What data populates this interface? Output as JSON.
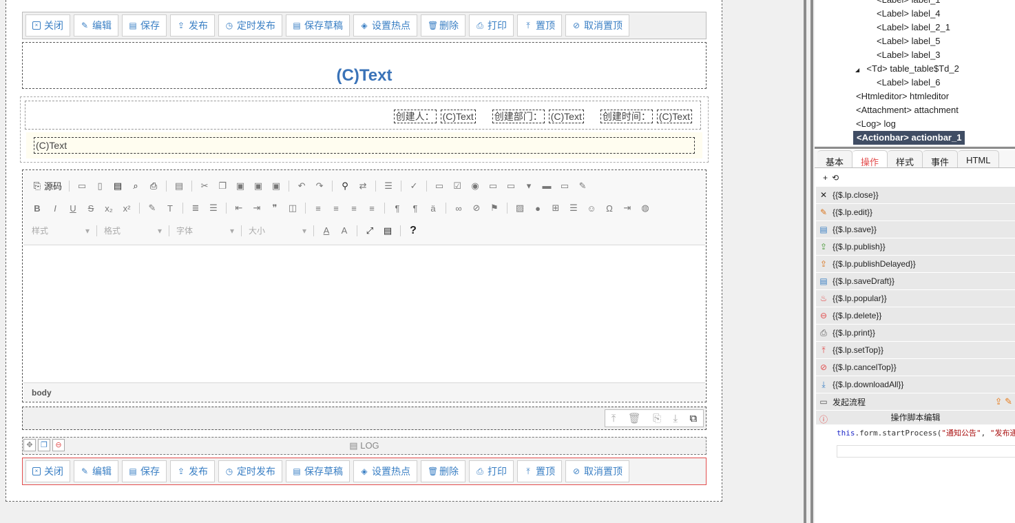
{
  "actionbar_top": {
    "buttons": [
      {
        "icon": "close-box-icon",
        "label": "关闭"
      },
      {
        "icon": "pencil-icon",
        "label": "编辑"
      },
      {
        "icon": "save-icon",
        "label": "保存"
      },
      {
        "icon": "publish-icon",
        "label": "发布"
      },
      {
        "icon": "timer-doc-icon",
        "label": "定时发布"
      },
      {
        "icon": "save-icon",
        "label": "保存草稿"
      },
      {
        "icon": "hotspot-icon",
        "label": "设置热点"
      },
      {
        "icon": "trash-icon",
        "label": "删除"
      },
      {
        "icon": "printer-icon",
        "label": "打印"
      },
      {
        "icon": "pin-top-icon",
        "label": "置顶"
      },
      {
        "icon": "cancel-top-icon",
        "label": "取消置顶"
      }
    ]
  },
  "form": {
    "title": "(C)Text",
    "creator_label": "创建人：",
    "creator_value": "(C)Text",
    "dept_label": "创建部门：",
    "dept_value": "(C)Text",
    "time_label": "创建时间：",
    "time_value": "(C)Text",
    "text_field": "(C)Text"
  },
  "editor": {
    "source_label": "源码",
    "style_dd": "样式",
    "format_dd": "格式",
    "font_dd": "字体",
    "size_dd": "大小",
    "help": "?",
    "status_path": "body"
  },
  "log": {
    "label": "LOG"
  },
  "tree": {
    "nodes": [
      {
        "text": "<Label> label_1",
        "indent": 90
      },
      {
        "text": "<Label> label_4",
        "indent": 90
      },
      {
        "text": "<Label> label_2_1",
        "indent": 90
      },
      {
        "text": "<Label> label_5",
        "indent": 90
      },
      {
        "text": "<Label> label_3",
        "indent": 90
      },
      {
        "text": "<Td> table_table$Td_2",
        "indent": 75,
        "expander": "◢"
      },
      {
        "text": "<Label> label_6",
        "indent": 90
      },
      {
        "text": "<Htmleditor> htmleditor",
        "indent": 60
      },
      {
        "text": "<Attachment> attachment",
        "indent": 60
      },
      {
        "text": "<Log> log",
        "indent": 60
      },
      {
        "text": "<Actionbar> actionbar_1",
        "indent": 56,
        "selected": true
      }
    ]
  },
  "props": {
    "tabs": [
      {
        "label": "基本"
      },
      {
        "label": "操作",
        "active": true
      },
      {
        "label": "样式"
      },
      {
        "label": "事件"
      },
      {
        "label": "HTML"
      }
    ],
    "toolbar_add": "+",
    "toolbar_refresh": "⟲",
    "actions": [
      {
        "icon": "x-icon",
        "label": "{{$.lp.close}}"
      },
      {
        "icon": "pencil-icon",
        "label": "{{$.lp.edit}}"
      },
      {
        "icon": "save-icon",
        "label": "{{$.lp.save}}"
      },
      {
        "icon": "publish-icon",
        "label": "{{$.lp.publish}}"
      },
      {
        "icon": "publish-delayed-icon",
        "label": "{{$.lp.publishDelayed}}"
      },
      {
        "icon": "save-icon",
        "label": "{{$.lp.saveDraft}}"
      },
      {
        "icon": "flame-icon",
        "label": "{{$.lp.popular}}"
      },
      {
        "icon": "delete-circle-icon",
        "label": "{{$.lp.delete}}"
      },
      {
        "icon": "printer-icon",
        "label": "{{$.lp.print}}"
      },
      {
        "icon": "pin-top-icon",
        "label": "{{$.lp.setTop}}"
      },
      {
        "icon": "cancel-top-icon",
        "label": "{{$.lp.cancelTop}}"
      },
      {
        "icon": "download-icon",
        "label": "{{$.lp.downloadAll}}"
      },
      {
        "icon": "flow-icon",
        "label": "发起流程"
      }
    ],
    "script_header": "操作脚本编辑",
    "code_kw": "this",
    "code_rest": ".form.startProcess(",
    "code_str1": "\"通知公告\"",
    "code_sep": ", ",
    "code_str2": "\"发布通"
  }
}
